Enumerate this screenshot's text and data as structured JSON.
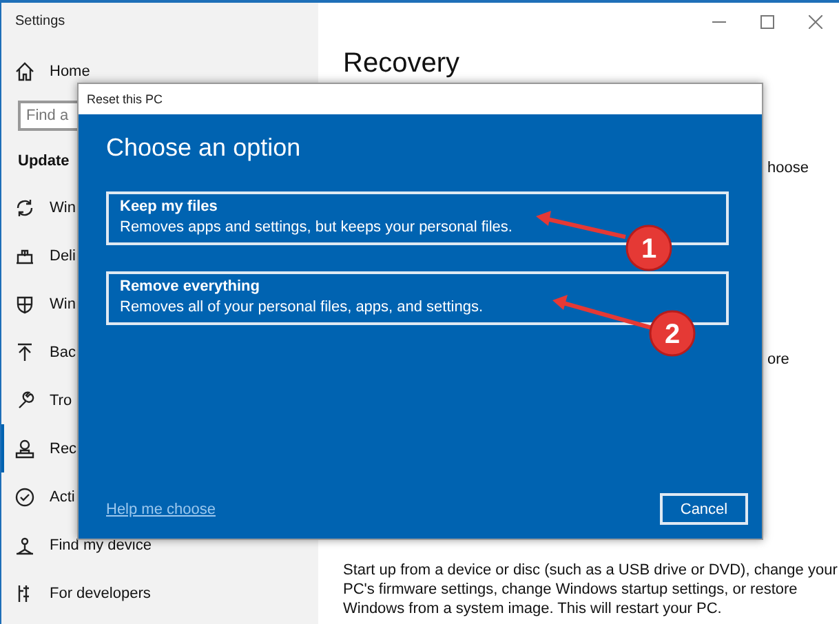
{
  "window": {
    "title": "Settings"
  },
  "sidebar": {
    "home": "Home",
    "search": {
      "placeholder": "Find a"
    },
    "section": "Update",
    "items": [
      {
        "label": "Win",
        "selected": false
      },
      {
        "label": "Deli",
        "selected": false
      },
      {
        "label": "Win",
        "selected": false
      },
      {
        "label": "Bac",
        "selected": false
      },
      {
        "label": "Tro",
        "selected": false
      },
      {
        "label": "Rec",
        "selected": true
      },
      {
        "label": "Acti",
        "selected": false
      },
      {
        "label": "Find my device",
        "selected": false
      },
      {
        "label": "For developers",
        "selected": false
      }
    ]
  },
  "main": {
    "heading": "Recovery",
    "fragments": [
      "hoose",
      "ore"
    ],
    "paragraph": "Start up from a device or disc (such as a USB drive or DVD), change your PC's firmware settings, change Windows startup settings, or restore Windows from a system image. This will restart your PC."
  },
  "dialog": {
    "title": "Reset this PC",
    "heading": "Choose an option",
    "options": [
      {
        "title": "Keep my files",
        "description": "Removes apps and settings, but keeps your personal files."
      },
      {
        "title": "Remove everything",
        "description": "Removes all of your personal files, apps, and settings."
      }
    ],
    "help_link": "Help me choose",
    "cancel": "Cancel"
  },
  "callouts": [
    "1",
    "2"
  ]
}
